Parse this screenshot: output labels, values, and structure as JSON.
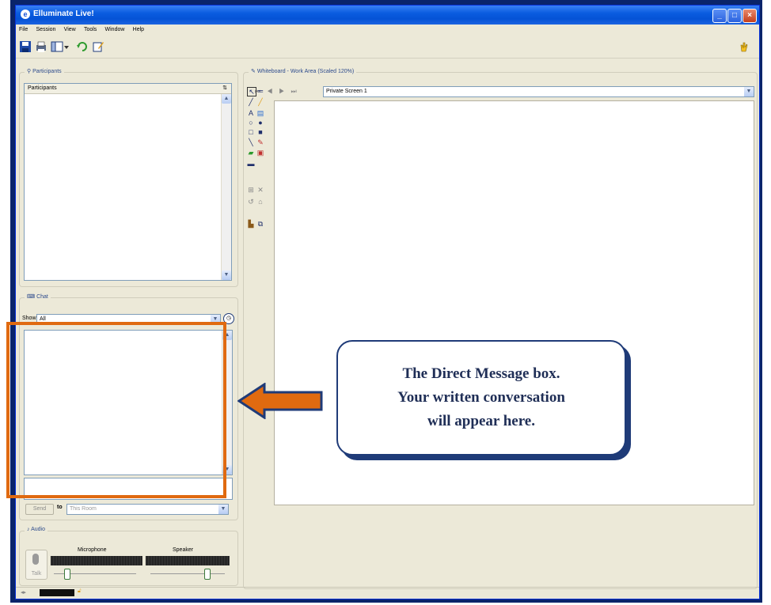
{
  "window": {
    "title": "Elluminate Live!",
    "app_icon": "e"
  },
  "titlebar_buttons": {
    "minimize": "_",
    "maximize": "□",
    "close": "×"
  },
  "menu": [
    "File",
    "Session",
    "View",
    "Tools",
    "Window",
    "Help"
  ],
  "toolbar": {
    "icons": [
      "save-icon",
      "print-icon",
      "layout-icon",
      "dropdown-icon",
      "refresh-icon",
      "edit-icon"
    ],
    "hand_icon": "hand-icon"
  },
  "participants": {
    "panel_title": "Participants",
    "column_header": "Participants",
    "sort_icon": "⇅"
  },
  "chat": {
    "panel_title": "Chat",
    "show_label": "Show",
    "show_value": "All",
    "send_label": "Send",
    "to_label": "to",
    "to_value": "This Room"
  },
  "audio": {
    "panel_title": "Audio",
    "talk_label": "Talk",
    "microphone_label": "Microphone",
    "speaker_label": "Speaker",
    "microphone_level": 0.15,
    "speaker_level": 0.75
  },
  "whiteboard": {
    "panel_title": "Whiteboard - Work Area (Scaled 120%)",
    "screen_value": "Private Screen 1"
  },
  "callout": {
    "line1": "The Direct Message box.",
    "line2": "Your written conversation",
    "line3": "will appear here."
  },
  "colors": {
    "highlight": "#e06a10",
    "callout_border": "#1f3b78",
    "title_bar": "#0553d6"
  }
}
